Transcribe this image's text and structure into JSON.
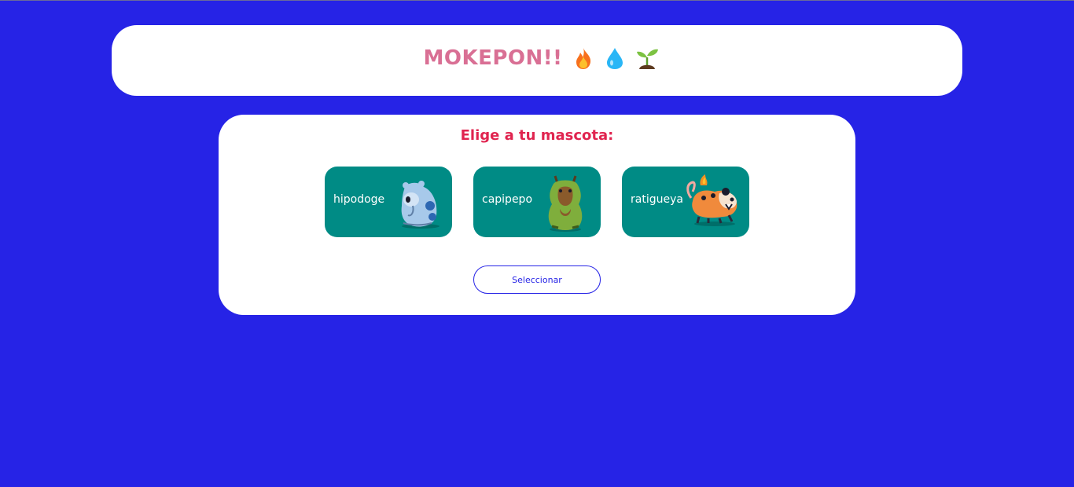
{
  "header": {
    "title": "MOKEPON!!",
    "element_icons": [
      "fire-icon",
      "water-drop-icon",
      "sprout-icon"
    ]
  },
  "selection": {
    "prompt": "Elige a tu mascota:",
    "pets": [
      {
        "name": "hipodoge",
        "image": "hipodoge-image"
      },
      {
        "name": "capipepo",
        "image": "capipepo-image"
      },
      {
        "name": "ratigueya",
        "image": "ratigueya-image"
      }
    ],
    "select_button": "Seleccionar"
  },
  "colors": {
    "background": "#2623e6",
    "card": "#ffffff",
    "title": "#d96f94",
    "prompt": "#e0244f",
    "pet_card": "#008b85",
    "button_border": "#2623e6"
  }
}
